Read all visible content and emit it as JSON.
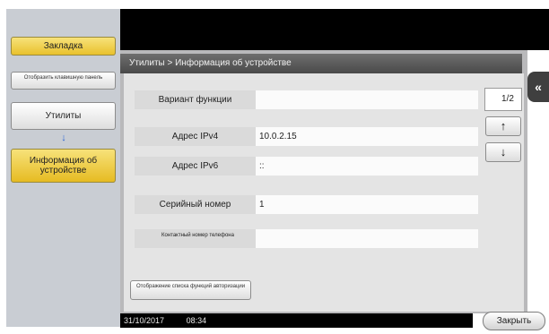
{
  "sidebar": {
    "bookmark_label": "Закладка",
    "keypad_label": "Отобразить клавишную панель",
    "utility_label": "Утилиты",
    "device_info_label": "Информация об устройстве"
  },
  "header": {
    "breadcrumb": "Утилиты > Информация об устройстве"
  },
  "rows": [
    {
      "label": "Вариант функции",
      "value": ""
    },
    {
      "label": "Адрес IPv4",
      "value": "10.0.2.15"
    },
    {
      "label": "Адрес IPv6",
      "value": "::"
    },
    {
      "label": "Серийный номер",
      "value": "1"
    },
    {
      "label": "Контактный номер телефона",
      "value": ""
    }
  ],
  "pager": {
    "text": "1/2",
    "up_icon": "arrow-up",
    "down_icon": "arrow-down"
  },
  "auth_button_label": "Отображение списка функций авторизации",
  "status": {
    "date": "31/10/2017",
    "time": "08:34"
  },
  "close_label": "Закрыть",
  "colors": {
    "accent": "#e9c12d",
    "panel_title": "#4a4a4a",
    "nav_arrow": "#2a66d6"
  }
}
